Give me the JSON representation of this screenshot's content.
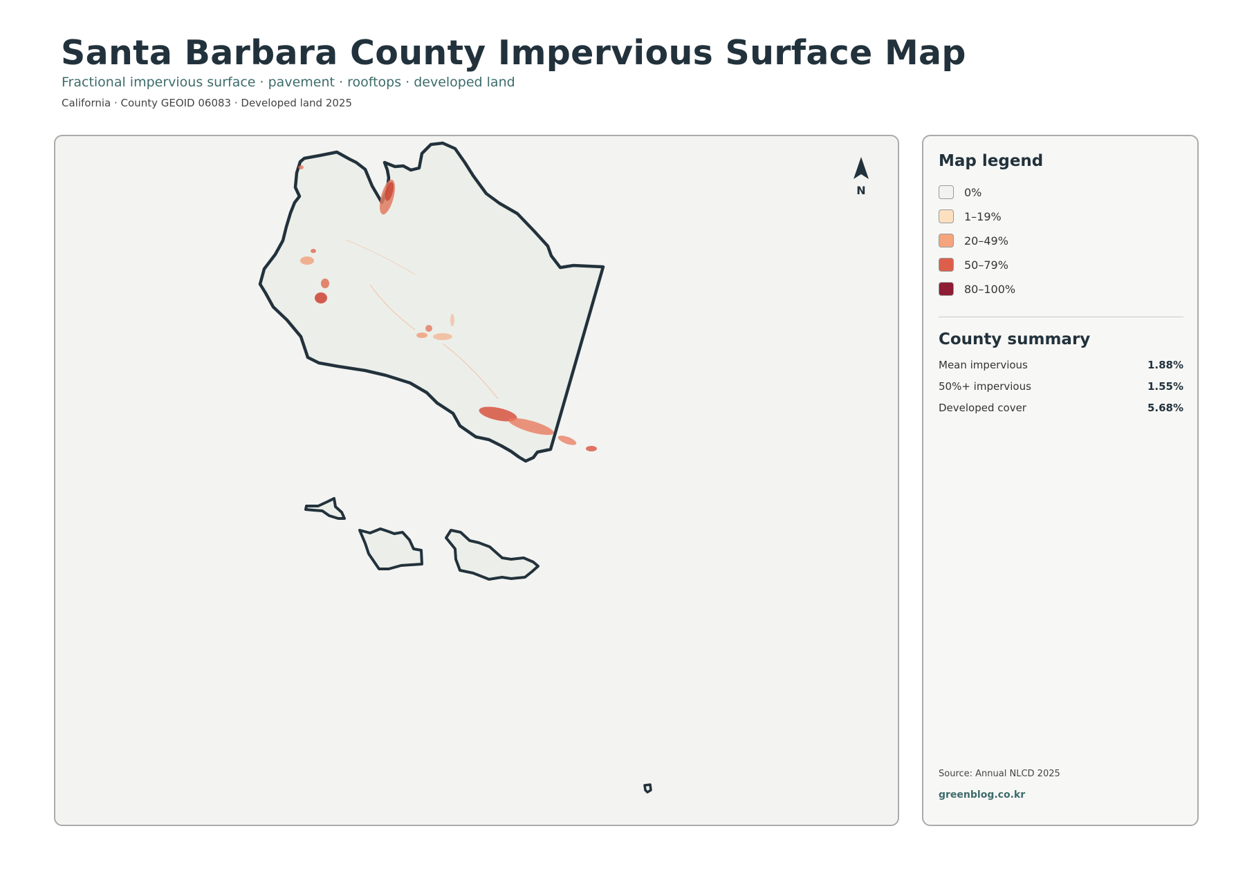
{
  "header": {
    "title": "Santa Barbara County Impervious Surface Map",
    "subtitle": "Fractional impervious surface · pavement · rooftops · developed land",
    "meta": "California · County GEOID 06083 · Developed land 2025"
  },
  "map": {
    "north_arrow_label": "N",
    "land_color": "#eceee9",
    "outline_color": "#22323c",
    "background_color": "#f3f3f1"
  },
  "legend": {
    "title": "Map legend",
    "items": [
      {
        "label": "0%",
        "color": "#f2f2f0"
      },
      {
        "label": "1–19%",
        "color": "#fde0c0"
      },
      {
        "label": "20–49%",
        "color": "#f4a57e"
      },
      {
        "label": "50–79%",
        "color": "#dd5f4b"
      },
      {
        "label": "80–100%",
        "color": "#8e1c34"
      }
    ]
  },
  "summary": {
    "title": "County summary",
    "stats": [
      {
        "label": "Mean impervious",
        "value": "1.88%"
      },
      {
        "label": "50%+ impervious",
        "value": "1.55%"
      },
      {
        "label": "Developed cover",
        "value": "5.68%"
      }
    ]
  },
  "footer": {
    "source": "Source: Annual NLCD 2025",
    "brand": "greenblog.co.kr"
  }
}
